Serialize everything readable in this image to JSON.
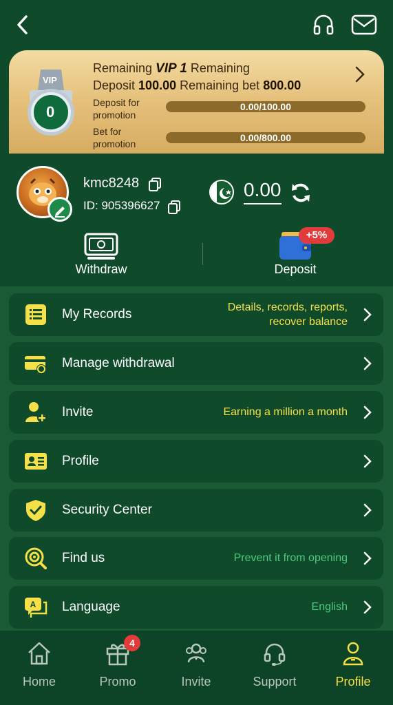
{
  "colors": {
    "accent_yellow": "#f6e04a",
    "accent_green_text": "#4ecb7f",
    "background": "#0f4a2b",
    "badge_red": "#e23b3b"
  },
  "header": {
    "back_icon": "chevron-left-icon",
    "support_icon": "headset-icon",
    "mail_icon": "mail-icon"
  },
  "vip": {
    "medal_tag": "VIP",
    "medal_level": "0",
    "line1_a": "Remaining ",
    "line1_vip": "VIP 1",
    "line1_b": " Remaining",
    "line2_a": "Deposit ",
    "line2_deposit": "100.00",
    "line2_b": " Remaining bet ",
    "line2_bet": "800.00",
    "deposit_label_1": "Deposit for",
    "deposit_label_2": "promotion",
    "deposit_progress": "0.00/100.00",
    "deposit_progress_value": 0,
    "bet_label_1": "Bet for",
    "bet_label_2": "promotion",
    "bet_progress": "0.00/800.00",
    "bet_progress_value": 0
  },
  "user": {
    "username": "kmc8248",
    "id": "ID: 905396627",
    "balance": "0.00",
    "flag": "pakistan-flag",
    "withdraw_label": "Withdraw",
    "deposit_label": "Deposit",
    "deposit_bonus": "+5%"
  },
  "menu": [
    {
      "title": "My Records",
      "sub1": "Details, records, reports,",
      "sub2": "recover balance",
      "icon": "records-icon"
    },
    {
      "title": "Manage withdrawal",
      "sub1": "",
      "sub2": "",
      "icon": "card-icon"
    },
    {
      "title": "Invite",
      "sub1": "Earning a million a month",
      "sub2": "",
      "icon": "add-user-icon"
    },
    {
      "title": "Profile",
      "sub1": "",
      "sub2": "",
      "icon": "id-card-icon"
    },
    {
      "title": "Security Center",
      "sub1": "",
      "sub2": "",
      "icon": "shield-icon"
    },
    {
      "title": "Find us",
      "sub1": "Prevent it from opening",
      "sub2": "",
      "icon": "target-search-icon"
    },
    {
      "title": "Language",
      "sub1": "English",
      "sub2": "",
      "icon": "language-icon"
    }
  ],
  "tabs": [
    {
      "label": "Home",
      "icon": "home-icon"
    },
    {
      "label": "Promo",
      "icon": "gift-icon",
      "badge": "4"
    },
    {
      "label": "Invite",
      "icon": "users-icon"
    },
    {
      "label": "Support",
      "icon": "headset-icon"
    },
    {
      "label": "Profile",
      "icon": "user-icon"
    }
  ]
}
